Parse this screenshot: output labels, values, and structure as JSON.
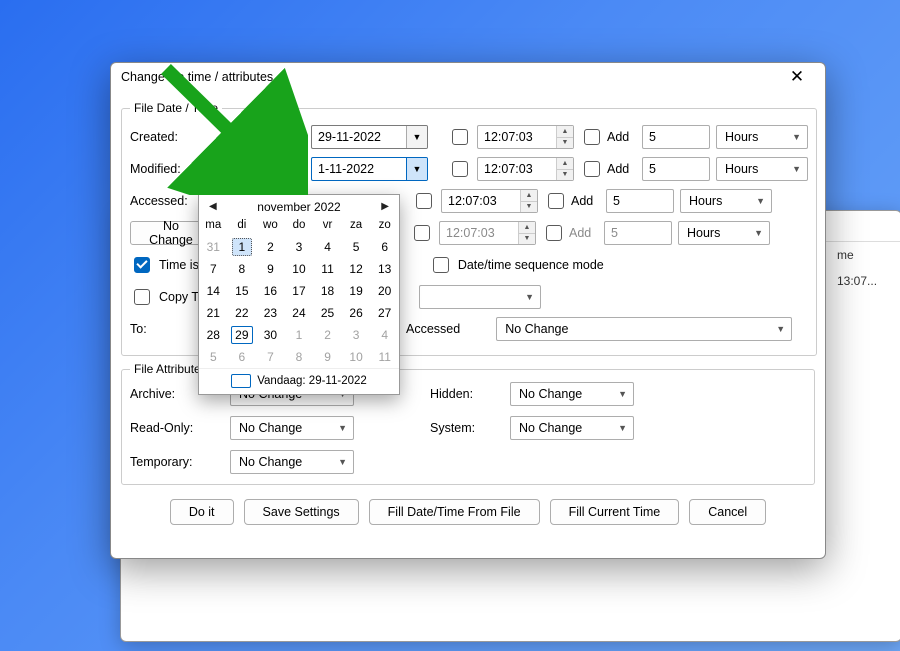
{
  "window_title": "Change file time / attributes",
  "groups": {
    "file_date": "File Date / Time",
    "file_attr": "File Attributes"
  },
  "labels": {
    "created": "Created:",
    "modified": "Modified:",
    "accessed": "Accessed:",
    "to": "To:",
    "archive": "Archive:",
    "readonly": "Read-Only:",
    "temporary": "Temporary:",
    "hidden": "Hidden:",
    "system": "System:",
    "accessed_word": "Accessed",
    "time_is": "Time is",
    "copy_t": "Copy T",
    "seq_mode": "Date/time sequence mode"
  },
  "rows": {
    "created": {
      "enabled": false,
      "date": "29-11-2022",
      "time": "12:07:03",
      "add_label": "Add",
      "add_checked": false,
      "num": "5",
      "unit": "Hours"
    },
    "modified": {
      "enabled": true,
      "date": "1-11-2022",
      "time": "12:07:03",
      "add_label": "Add",
      "add_checked": false,
      "num": "5",
      "unit": "Hours"
    },
    "accessed": {
      "enabled": false,
      "date": "",
      "time": "12:07:03",
      "add_label": "Add",
      "add_checked": false,
      "num": "5",
      "unit": "Hours"
    },
    "nochange": {
      "button": "No Change",
      "time": "12:07:03",
      "add_label": "Add",
      "add_checked": false,
      "num": "5",
      "unit": "Hours",
      "disabled": true
    }
  },
  "to_combo": "No Change",
  "attributes": {
    "archive": "No Change",
    "readonly": "No Change",
    "temporary": "No Change",
    "hidden": "No Change",
    "system": "No Change"
  },
  "buttons": {
    "doit": "Do it",
    "save": "Save Settings",
    "fill_file": "Fill Date/Time From File",
    "fill_now": "Fill Current Time",
    "cancel": "Cancel"
  },
  "calendar": {
    "title": "november 2022",
    "weekdays": [
      "ma",
      "di",
      "wo",
      "do",
      "vr",
      "za",
      "zo"
    ],
    "cells": [
      [
        "31",
        "1",
        "2",
        "3",
        "4",
        "5",
        "6"
      ],
      [
        "7",
        "8",
        "9",
        "10",
        "11",
        "12",
        "13"
      ],
      [
        "14",
        "15",
        "16",
        "17",
        "18",
        "19",
        "20"
      ],
      [
        "21",
        "22",
        "23",
        "24",
        "25",
        "26",
        "27"
      ],
      [
        "28",
        "29",
        "30",
        "1",
        "2",
        "3",
        "4"
      ],
      [
        "5",
        "6",
        "7",
        "8",
        "9",
        "10",
        "11"
      ]
    ],
    "other_prev": [
      "31"
    ],
    "other_next_start_row": 4,
    "selected": "1",
    "today": "29",
    "footer": "Vandaag: 29-11-2022"
  },
  "bg": {
    "col": "me",
    "cell": "13:07..."
  }
}
